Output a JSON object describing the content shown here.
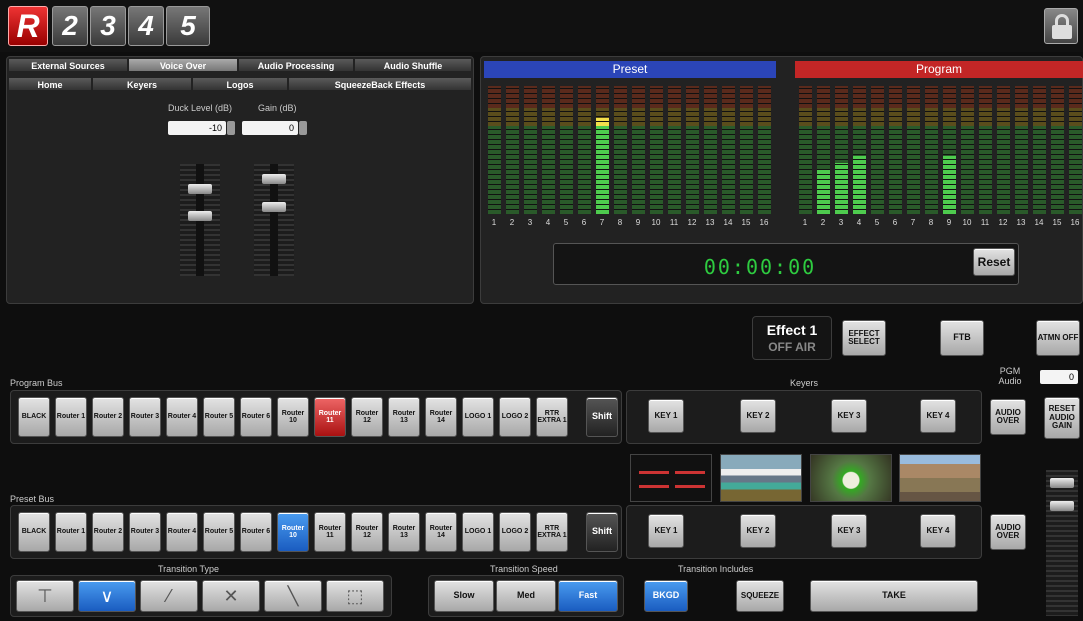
{
  "top": {
    "logo": "R",
    "tabs": [
      "2",
      "3",
      "4",
      "5"
    ]
  },
  "audio_tabs": {
    "row1": [
      "External Sources",
      "Voice Over",
      "Audio Processing",
      "Audio Shuffle"
    ],
    "row2": [
      "Home",
      "Keyers",
      "Logos",
      "SqueezeBack Effects"
    ]
  },
  "voice_over": {
    "duck_label": "Duck Level (dB)",
    "duck_value": "-10",
    "gain_label": "Gain (dB)",
    "gain_value": "0"
  },
  "meters": {
    "preset_title": "Preset",
    "program_title": "Program",
    "channels": [
      "1",
      "2",
      "3",
      "4",
      "5",
      "6",
      "7",
      "8",
      "9",
      "10",
      "11",
      "12",
      "13",
      "14",
      "15",
      "16"
    ],
    "preset_levels": [
      0,
      0,
      0,
      0,
      0,
      0,
      0.75,
      0,
      0,
      0,
      0,
      0,
      0,
      0,
      0,
      0
    ],
    "program_levels": [
      0,
      0.35,
      0.4,
      0.45,
      0,
      0,
      0,
      0,
      0.45,
      0,
      0,
      0,
      0,
      0,
      0,
      0
    ]
  },
  "timer": {
    "value": "00:00:00",
    "reset_label": "Reset"
  },
  "effect": {
    "title": "Effect 1",
    "status": "OFF AIR",
    "effect_select": "EFFECT SELECT",
    "ftb": "FTB",
    "atmn": "ATMN OFF"
  },
  "pgm_audio": {
    "label": "PGM Audio",
    "value": "0"
  },
  "program_bus": {
    "label": "Program Bus",
    "buttons": [
      "BLACK",
      "Router 1",
      "Router 2",
      "Router 3",
      "Router 4",
      "Router 5",
      "Router 6",
      "Router 10",
      "Router 11",
      "Router 12",
      "Router 13",
      "Router 14",
      "LOGO 1",
      "LOGO 2",
      "RTR EXTRA 1"
    ],
    "shift": "Shift",
    "selected": "Router 11"
  },
  "preset_bus": {
    "label": "Preset Bus",
    "buttons": [
      "BLACK",
      "Router 1",
      "Router 2",
      "Router 3",
      "Router 4",
      "Router 5",
      "Router 6",
      "Router 10",
      "Router 11",
      "Router 12",
      "Router 13",
      "Router 14",
      "LOGO 1",
      "LOGO 2",
      "RTR EXTRA 1"
    ],
    "shift": "Shift",
    "selected": "Router 10"
  },
  "keyers": {
    "label": "Keyers",
    "program_keys": [
      "KEY 1",
      "KEY 2",
      "KEY 3",
      "KEY 4"
    ],
    "preset_keys": [
      "KEY 1",
      "KEY 2",
      "KEY 3",
      "KEY 4"
    ],
    "audio_over": "AUDIO OVER",
    "reset_audio_gain": "RESET AUDIO GAIN",
    "thumbnails": [
      "red-lines",
      "mountain-lake",
      "flower-field",
      "hillside-town"
    ]
  },
  "transition_type": {
    "label": "Transition Type",
    "icons": [
      "wipe-t-icon",
      "wipe-v-icon",
      "wipe-diagonal-icon",
      "wipe-x-icon",
      "wipe-corner-icon",
      "wipe-box-icon"
    ],
    "selected": 1
  },
  "transition_speed": {
    "label": "Transition Speed",
    "options": [
      "Slow",
      "Med",
      "Fast"
    ],
    "selected": "Fast"
  },
  "transition_includes": {
    "label": "Transition Includes",
    "bkgd": "BKGD",
    "squeeze": "SQUEEZE",
    "take": "TAKE"
  },
  "colors": {
    "preset": "#2b45b8",
    "program": "#c32626",
    "selected_red": "#c0392b",
    "selected_blue": "#2a7de1",
    "timer": "#2ecc40"
  }
}
